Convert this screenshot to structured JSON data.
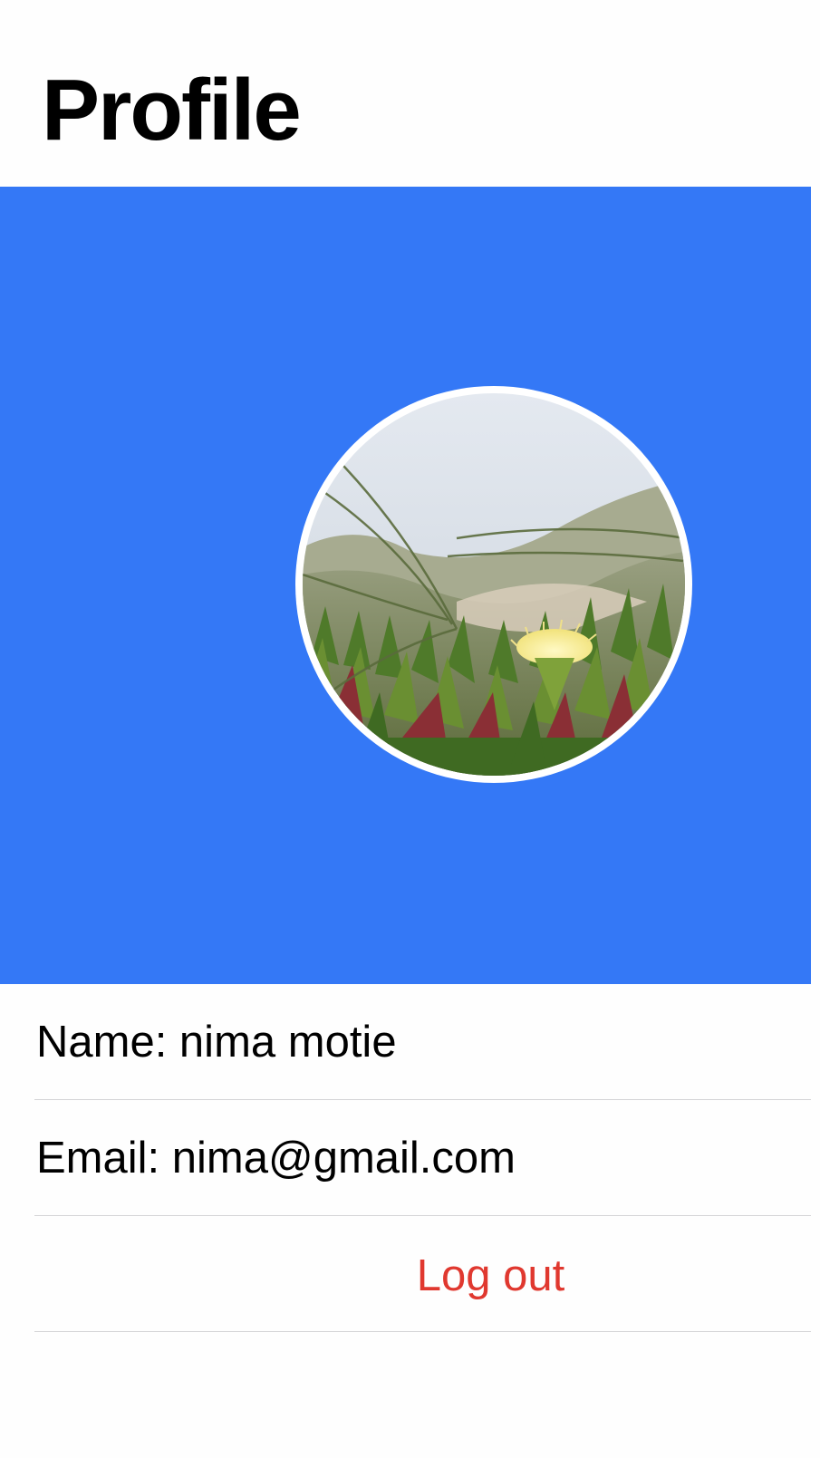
{
  "header": {
    "title": "Profile"
  },
  "banner": {
    "background_color": "#3478f6"
  },
  "avatar": {
    "image": "profile-photo-flower-icon"
  },
  "profile": {
    "name_text": "Name: nima motie",
    "email_text": "Email: nima@gmail.com"
  },
  "actions": {
    "logout_label": "Log out",
    "logout_color": "#e0382f"
  }
}
